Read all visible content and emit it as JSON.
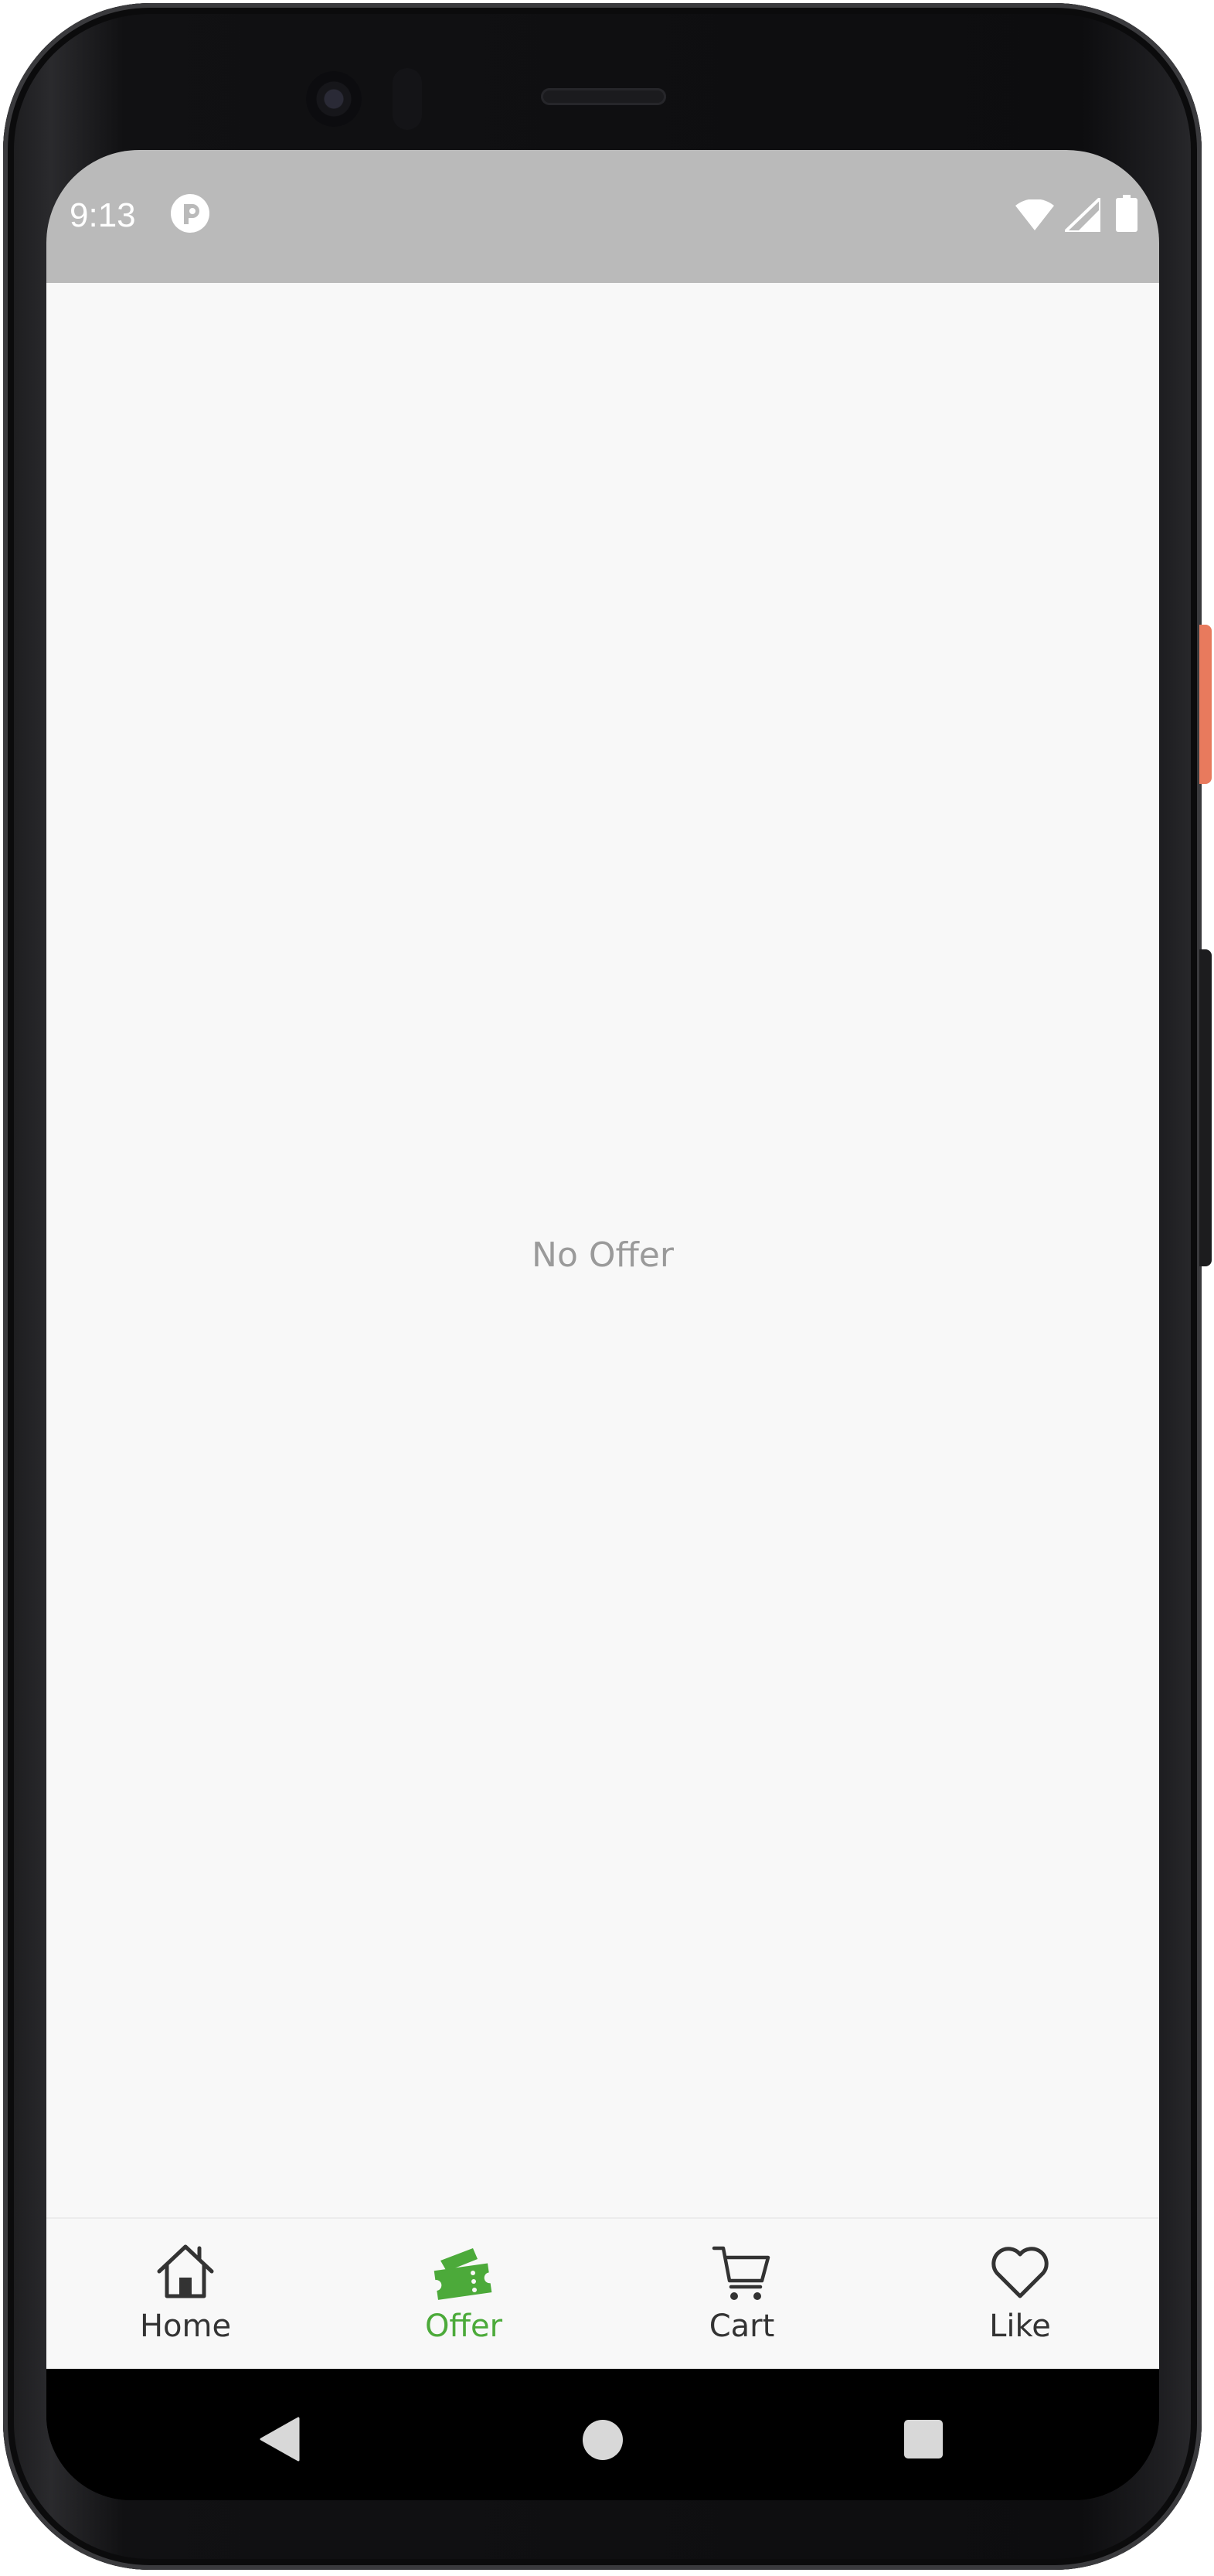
{
  "status_bar": {
    "time": "9:13"
  },
  "main": {
    "empty_message": "No Offer"
  },
  "bottom_nav": {
    "active_color": "#4caa3a",
    "items": [
      {
        "label": "Home",
        "icon": "home-icon",
        "active": false
      },
      {
        "label": "Offer",
        "icon": "ticket-icon",
        "active": true
      },
      {
        "label": "Cart",
        "icon": "cart-icon",
        "active": false
      },
      {
        "label": "Like",
        "icon": "heart-icon",
        "active": false
      }
    ]
  },
  "system_nav": {
    "buttons": [
      "back-icon",
      "home-circle-icon",
      "recents-icon"
    ]
  }
}
